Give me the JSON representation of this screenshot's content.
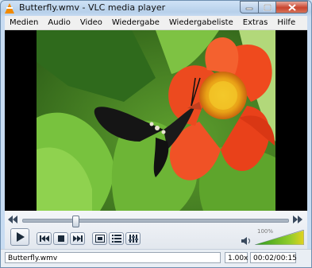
{
  "window": {
    "title": "Butterfly.wmv - VLC media player"
  },
  "menu": [
    "Medien",
    "Audio",
    "Video",
    "Wiedergabe",
    "Wiedergabeliste",
    "Extras",
    "Hilfe"
  ],
  "playback": {
    "position_fraction": 0.19,
    "volume_percent": "100%",
    "volume_fraction": 1.0
  },
  "status": {
    "filename": "Butterfly.wmv",
    "rate": "1.00x",
    "time": "00:02/00:15"
  },
  "colors": {
    "accent_orange": "#f28a00",
    "volume_green": "#4caf1a",
    "close_red": "#c9452f"
  },
  "icons": [
    "vlc-cone-icon",
    "minimize-icon",
    "maximize-icon",
    "close-icon",
    "seek-back-icon",
    "seek-forward-icon",
    "play-icon",
    "previous-icon",
    "stop-icon",
    "next-icon",
    "fullscreen-icon",
    "playlist-icon",
    "extended-settings-icon",
    "speaker-icon"
  ]
}
